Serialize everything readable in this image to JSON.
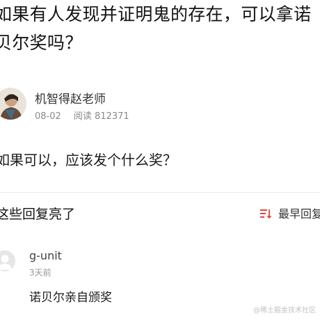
{
  "question": {
    "title": "如果有人发现并证明鬼的存在，可以拿诺贝尔奖吗？",
    "body": "如果可以，应该发个什么奖？"
  },
  "author": {
    "name": "机智得赵老师",
    "date": "08-02",
    "views_label": "阅读 812371"
  },
  "comments_section": {
    "title": "这些回复亮了",
    "sort_label": "最早回复"
  },
  "comments": [
    {
      "user": "g-unit",
      "time": "3天前",
      "text": "诺贝尔亲自颁奖"
    }
  ],
  "watermark": "@稀土掘金技术社区",
  "icons": {
    "sort": "sort-icon",
    "avatar_placeholder": "user-avatar-icon"
  },
  "colors": {
    "text_primary": "#121212",
    "text_muted": "#8a8a8a",
    "divider": "#ececec",
    "sort_icon": "#e0463b"
  }
}
